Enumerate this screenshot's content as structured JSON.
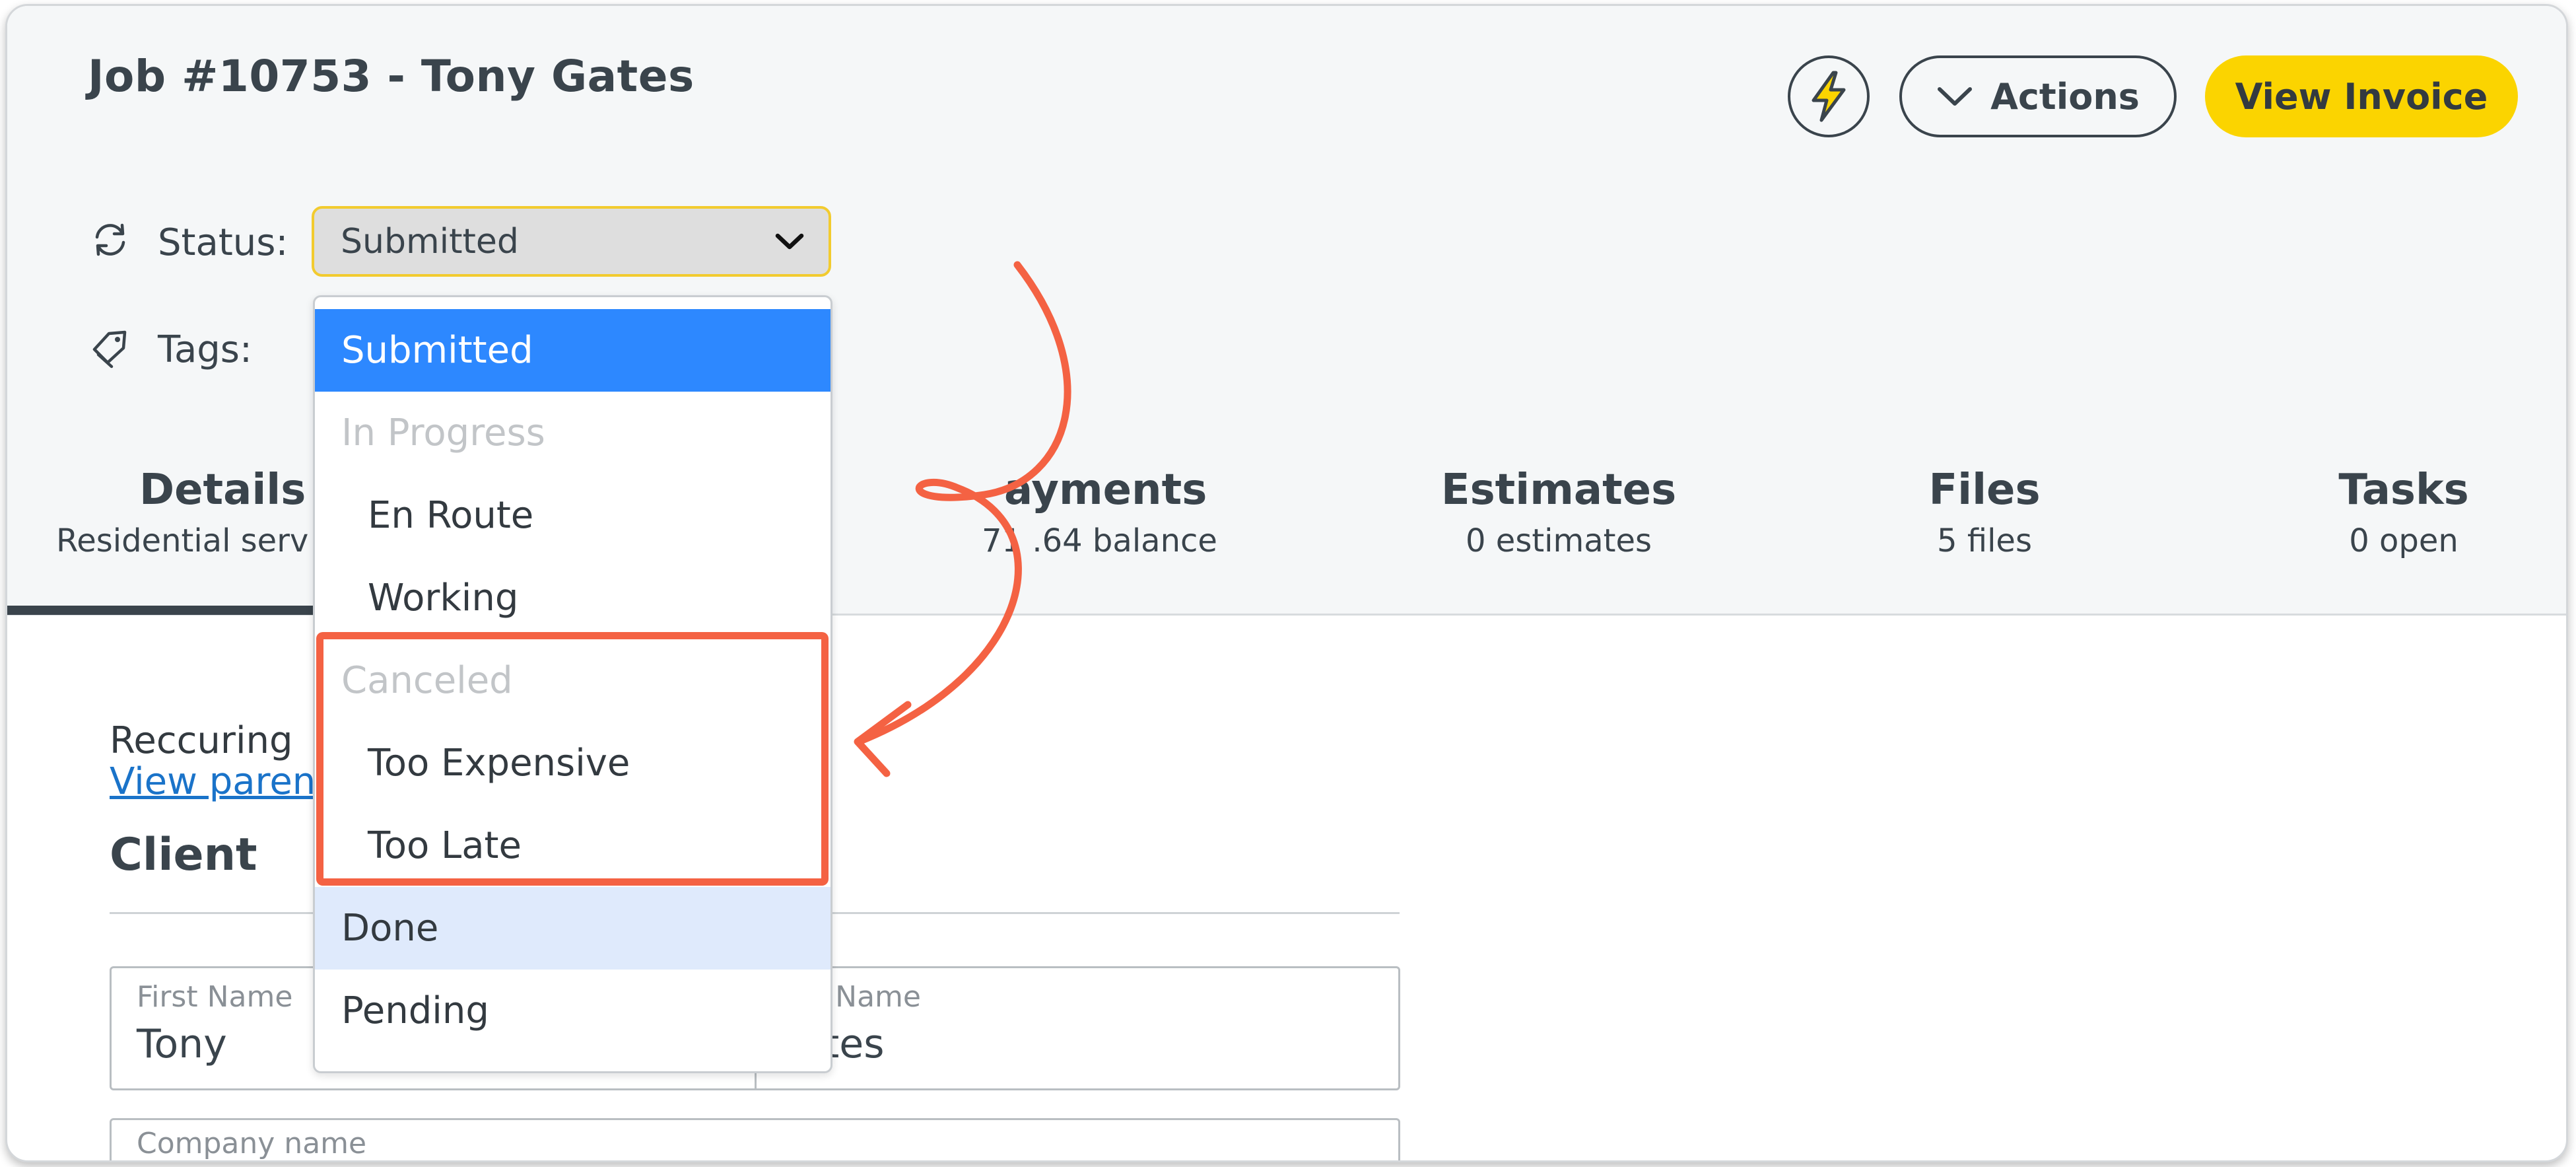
{
  "header": {
    "job_title": "Job #10753 - Tony Gates",
    "actions_label": "Actions",
    "view_invoice_label": "View Invoice"
  },
  "fields": {
    "status_label": "Status:",
    "status_value": "Submitted",
    "tags_label": "Tags:"
  },
  "tabs": [
    {
      "title": "Details",
      "sub": "Residential serv"
    },
    {
      "title": "ayments",
      "sub": "71 .64 balance"
    },
    {
      "title": "Estimates",
      "sub": "0 estimates"
    },
    {
      "title": "Files",
      "sub": "5 files"
    },
    {
      "title": "Tasks",
      "sub": "0 open"
    }
  ],
  "details": {
    "recurring_text": "Reccuring",
    "view_parent_link": "View paren",
    "client_heading": "Client",
    "first_name_label": "First Name",
    "first_name_value": "Tony",
    "last_name_label": "st Name",
    "last_name_value": "ates",
    "company_name_label": "Company name"
  },
  "status_dropdown": {
    "options": [
      {
        "label": "Submitted",
        "kind": "top",
        "state": "selected"
      },
      {
        "label": "In Progress",
        "kind": "group",
        "state": "disabled"
      },
      {
        "label": "En Route",
        "kind": "child",
        "state": "normal"
      },
      {
        "label": "Working",
        "kind": "child",
        "state": "normal"
      },
      {
        "label": "Canceled",
        "kind": "group",
        "state": "disabled"
      },
      {
        "label": "Too Expensive",
        "kind": "child",
        "state": "normal"
      },
      {
        "label": "Too Late",
        "kind": "child",
        "state": "normal"
      },
      {
        "label": "Done",
        "kind": "top",
        "state": "hover"
      },
      {
        "label": "Pending",
        "kind": "top",
        "state": "normal"
      }
    ]
  },
  "colors": {
    "accent_yellow": "#fbd400",
    "selected_blue": "#2d88ff",
    "annotation_red": "#f46243"
  },
  "icons": {
    "bolt": "lightning-bolt-icon",
    "actions": "chevron-down-icon",
    "status": "refresh-icon",
    "tags": "tag-icon"
  }
}
